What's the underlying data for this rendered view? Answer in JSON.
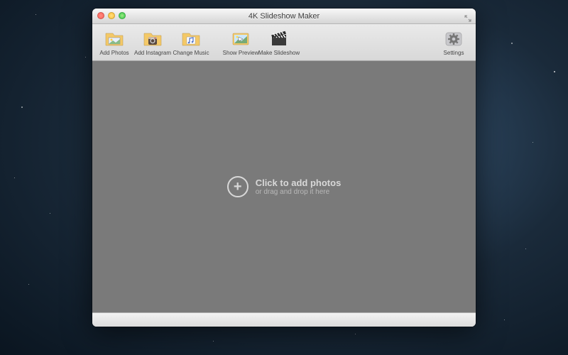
{
  "window": {
    "title": "4K Slideshow Maker"
  },
  "toolbar": {
    "add_photos": "Add Photos",
    "add_instagram": "Add Instagram",
    "change_music": "Change Music",
    "show_preview": "Show Preview",
    "make_slideshow": "Make Slideshow",
    "settings": "Settings"
  },
  "dropzone": {
    "title": "Click to add photos",
    "subtitle": "or drag and drop it here"
  }
}
